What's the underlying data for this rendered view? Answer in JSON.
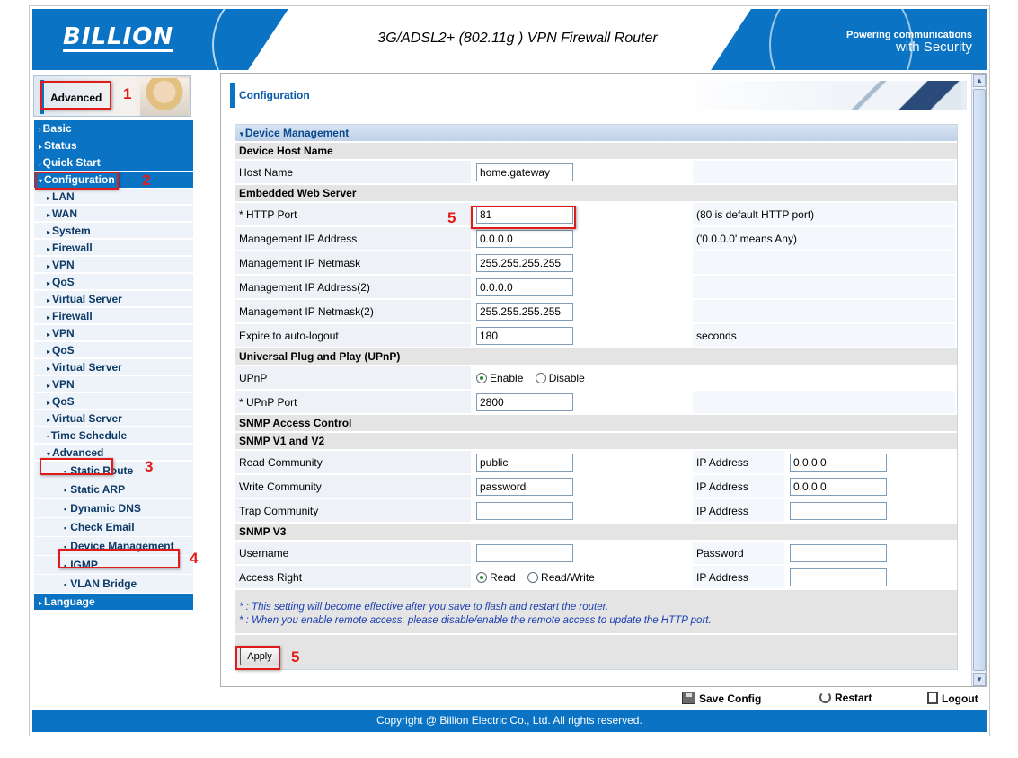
{
  "header": {
    "brand": "BILLION",
    "title": "3G/ADSL2+ (802.11g ) VPN Firewall Router",
    "tagline_1": "Powering communications",
    "tagline_2": "with Security"
  },
  "sidebar": {
    "banner_label": "Advanced",
    "menu": [
      {
        "label": "Basic",
        "level": "top",
        "arrow": "›"
      },
      {
        "label": "Status",
        "level": "top",
        "arrow": "▸"
      },
      {
        "label": "Quick Start",
        "level": "top",
        "arrow": "›"
      },
      {
        "label": "Configuration",
        "level": "top",
        "arrow": "▾"
      },
      {
        "label": "LAN",
        "level": "sub",
        "arrow": "▸"
      },
      {
        "label": "WAN",
        "level": "sub",
        "arrow": "▸"
      },
      {
        "label": "System",
        "level": "sub",
        "arrow": "▸"
      },
      {
        "label": "Firewall",
        "level": "sub",
        "arrow": "▸"
      },
      {
        "label": "VPN",
        "level": "sub",
        "arrow": "▸"
      },
      {
        "label": "QoS",
        "level": "sub",
        "arrow": "▸"
      },
      {
        "label": "Virtual Server",
        "level": "sub",
        "arrow": "▸"
      },
      {
        "label": "Firewall",
        "level": "sub",
        "arrow": "▸"
      },
      {
        "label": "VPN",
        "level": "sub",
        "arrow": "▸"
      },
      {
        "label": "QoS",
        "level": "sub",
        "arrow": "▸"
      },
      {
        "label": "Virtual Server",
        "level": "sub",
        "arrow": "▸"
      },
      {
        "label": "VPN",
        "level": "sub",
        "arrow": "▸"
      },
      {
        "label": "QoS",
        "level": "sub",
        "arrow": "▸"
      },
      {
        "label": "Virtual Server",
        "level": "sub",
        "arrow": "▸"
      },
      {
        "label": "Time Schedule",
        "level": "sub",
        "arrow": "·"
      },
      {
        "label": "Advanced",
        "level": "sub",
        "arrow": "▾"
      },
      {
        "label": "Static Route",
        "level": "sub2"
      },
      {
        "label": "Static ARP",
        "level": "sub2"
      },
      {
        "label": "Dynamic DNS",
        "level": "sub2"
      },
      {
        "label": "Check Email",
        "level": "sub2"
      },
      {
        "label": "Device Management",
        "level": "sub2"
      },
      {
        "label": "IGMP",
        "level": "sub2"
      },
      {
        "label": "VLAN Bridge",
        "level": "sub2"
      },
      {
        "label": "Language",
        "level": "top",
        "arrow": "▸"
      }
    ]
  },
  "annotations": [
    "1",
    "2",
    "3",
    "4",
    "5",
    "5"
  ],
  "content": {
    "header": "Configuration",
    "panel_title": "Device Management",
    "sections": {
      "host": "Device Host Name",
      "web": "Embedded Web Server",
      "upnp": "Universal Plug and Play (UPnP)",
      "snmp": "SNMP Access Control",
      "v1v2": "SNMP V1 and V2",
      "v3": "SNMP V3"
    },
    "host_name": {
      "label": "Host Name",
      "value": "home.gateway"
    },
    "http_port": {
      "label": "* HTTP Port",
      "value": "81",
      "hint": "(80 is default HTTP port)"
    },
    "mgmt_ip": {
      "label": "Management IP Address",
      "value": "0.0.0.0",
      "hint": "('0.0.0.0' means Any)"
    },
    "mgmt_mask": {
      "label": "Management IP Netmask",
      "value": "255.255.255.255"
    },
    "mgmt_ip2": {
      "label": "Management IP Address(2)",
      "value": "0.0.0.0"
    },
    "mgmt_mask2": {
      "label": "Management IP Netmask(2)",
      "value": "255.255.255.255"
    },
    "logout": {
      "label": "Expire to auto-logout",
      "value": "180",
      "unit": "seconds"
    },
    "upnp": {
      "label": "UPnP",
      "opt_enable": "Enable",
      "opt_disable": "Disable",
      "selected": "Enable"
    },
    "upnp_port": {
      "label": "* UPnP Port",
      "value": "2800"
    },
    "read_comm": {
      "label": "Read Community",
      "value": "public",
      "ip_label": "IP Address",
      "ip_value": "0.0.0.0"
    },
    "write_comm": {
      "label": "Write Community",
      "value": "password",
      "ip_label": "IP Address",
      "ip_value": "0.0.0.0"
    },
    "trap_comm": {
      "label": "Trap Community",
      "value": "",
      "ip_label": "IP Address",
      "ip_value": ""
    },
    "username": {
      "label": "Username",
      "value": "",
      "pw_label": "Password",
      "pw_value": ""
    },
    "access": {
      "label": "Access Right",
      "opt_read": "Read",
      "opt_rw": "Read/Write",
      "selected": "Read",
      "ip_label": "IP Address",
      "ip_value": ""
    },
    "note_1": "* : This setting will become effective after you save to flash and restart the router.",
    "note_2": "* : When you enable remote access, please disable/enable the remote access to update the HTTP port.",
    "apply": "Apply"
  },
  "actions": {
    "save": "Save Config",
    "restart": "Restart",
    "logout": "Logout"
  },
  "footer": "Copyright @ Billion Electric Co., Ltd. All rights reserved."
}
